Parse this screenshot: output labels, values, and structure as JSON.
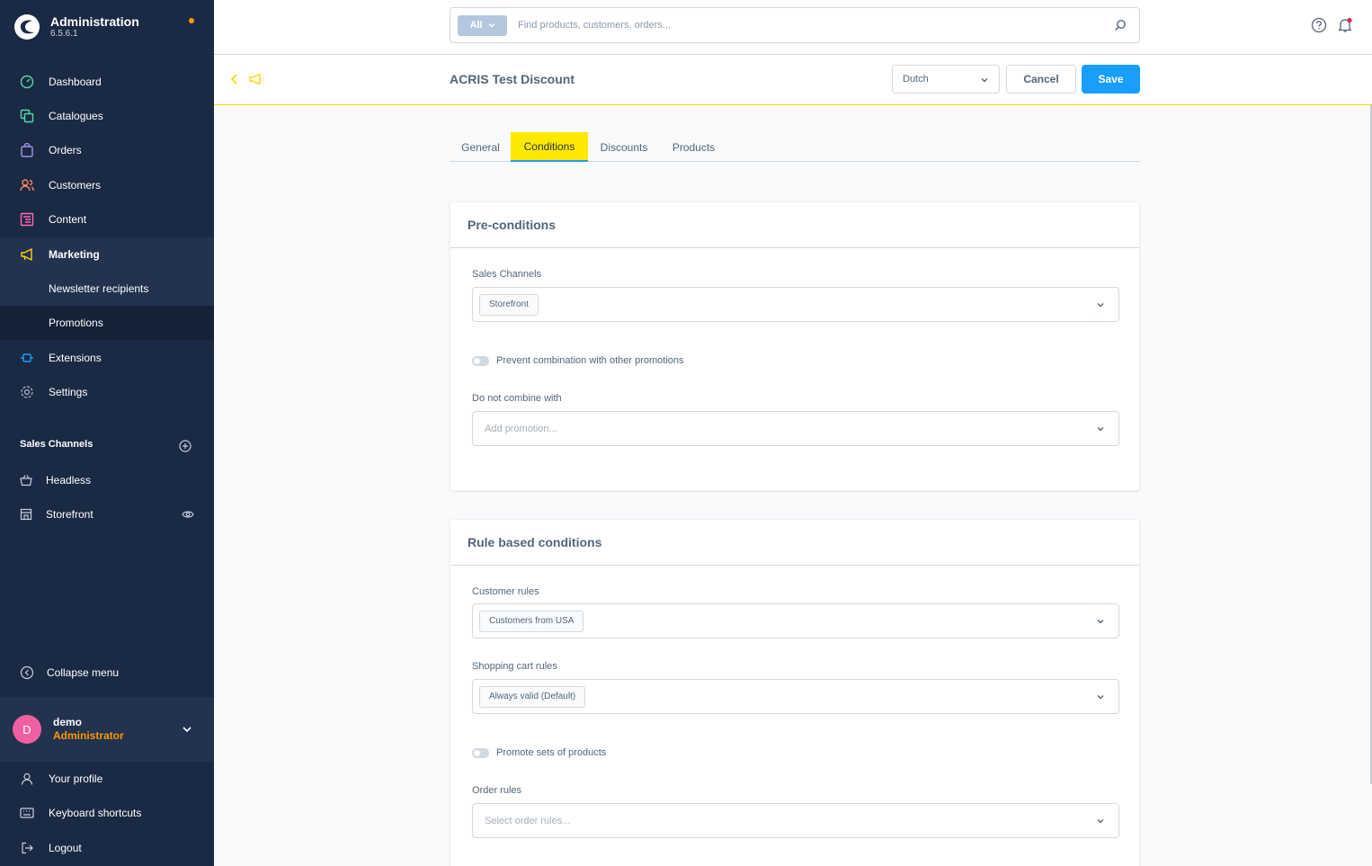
{
  "app": {
    "title": "Administration",
    "version": "6.5.6.1",
    "colors": {
      "sidebar": "#1b2a44",
      "accent": "#189eff",
      "highlight": "#fde900",
      "notice": "#ff9800"
    }
  },
  "nav": {
    "items": [
      {
        "label": "Dashboard",
        "icon": "dashboard-icon"
      },
      {
        "label": "Catalogues",
        "icon": "catalogue-icon"
      },
      {
        "label": "Orders",
        "icon": "shopping-bag-icon"
      },
      {
        "label": "Customers",
        "icon": "users-icon"
      },
      {
        "label": "Content",
        "icon": "content-icon"
      },
      {
        "label": "Marketing",
        "icon": "megaphone-icon"
      },
      {
        "label": "Extensions",
        "icon": "plug-icon"
      },
      {
        "label": "Settings",
        "icon": "gear-icon"
      }
    ],
    "marketing_sub": [
      "Newsletter recipients",
      "Promotions"
    ]
  },
  "sales_channels": {
    "title": "Sales Channels",
    "items": [
      {
        "label": "Headless",
        "icon": "basket-icon"
      },
      {
        "label": "Storefront",
        "icon": "store-icon"
      }
    ]
  },
  "collapse_label": "Collapse menu",
  "user": {
    "initial": "D",
    "name": "demo",
    "role": "Administrator"
  },
  "bottom_menu": [
    "Your profile",
    "Keyboard shortcuts",
    "Logout"
  ],
  "search": {
    "type": "All",
    "placeholder": "Find products, customers, orders..."
  },
  "smartbar": {
    "title": "ACRIS Test Discount",
    "language": "Dutch",
    "cancel": "Cancel",
    "save": "Save"
  },
  "tabs": [
    "General",
    "Conditions",
    "Discounts",
    "Products"
  ],
  "active_tab": "Conditions",
  "pre_conditions": {
    "title": "Pre-conditions",
    "sales_channels_label": "Sales Channels",
    "sales_channels_value": "Storefront",
    "prevent_combination_label": "Prevent combination with other promotions",
    "do_not_combine_label": "Do not combine with",
    "do_not_combine_placeholder": "Add promotion..."
  },
  "rule_conditions": {
    "title": "Rule based conditions",
    "customer_rules_label": "Customer rules",
    "customer_rules_value": "Customers from USA",
    "cart_rules_label": "Shopping cart rules",
    "cart_rules_value": "Always valid (Default)",
    "promote_sets_label": "Promote sets of products",
    "order_rules_label": "Order rules",
    "order_rules_placeholder": "Select order rules..."
  }
}
